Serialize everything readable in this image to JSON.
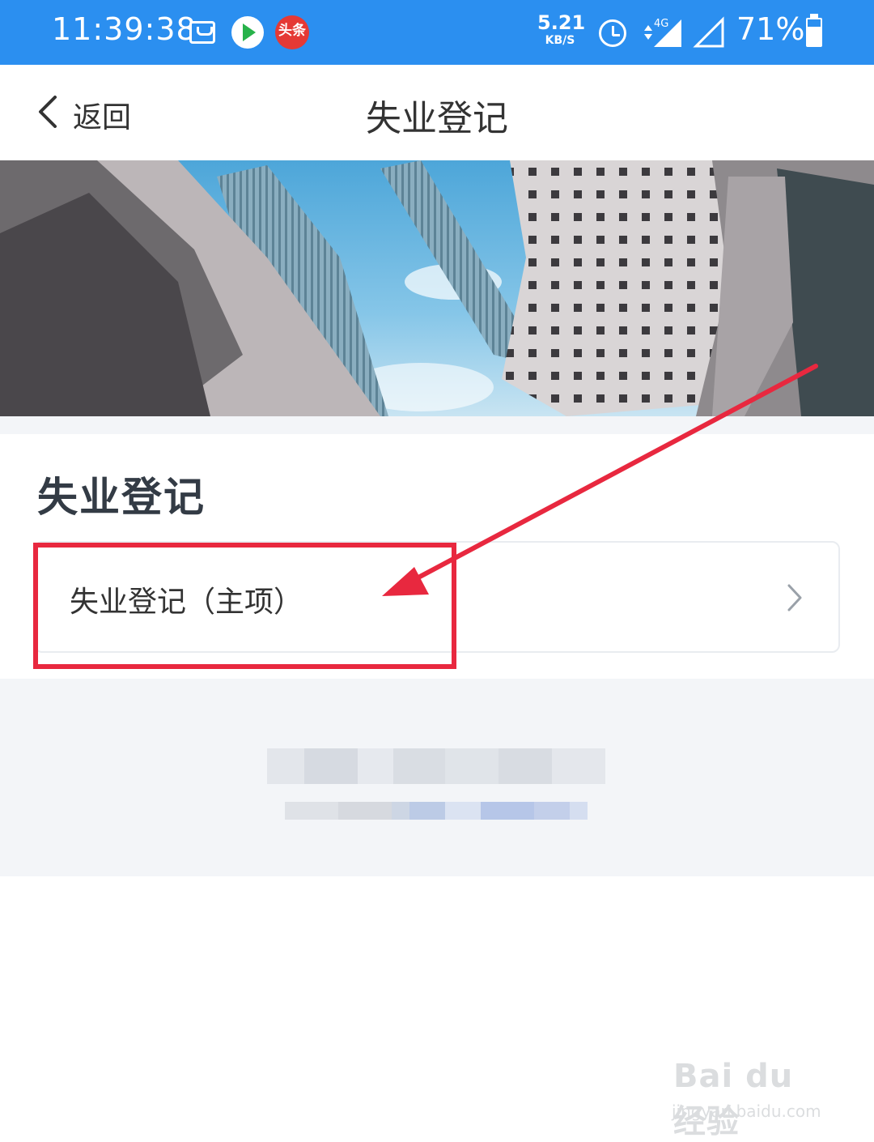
{
  "status_bar": {
    "time": "11:39:38",
    "net_speed_value": "5.21",
    "net_speed_unit": "KB/S",
    "network_type": "4G",
    "battery_percent": "71%",
    "toutiao_label": "头条",
    "icons": [
      "mail-icon",
      "video-app-icon",
      "toutiao-icon",
      "alarm-icon",
      "signal-4g-icon",
      "signal-icon",
      "battery-icon"
    ],
    "background_color": "#2b8ff0"
  },
  "nav": {
    "back_label": "返回",
    "title": "失业登记"
  },
  "banner": {
    "subject": "banner-image"
  },
  "section": {
    "title": "失业登记",
    "items": [
      {
        "label": "失业登记（主项）",
        "icon": "chevron-right-icon"
      }
    ]
  },
  "watermark": {
    "logo": "Bai du 经验",
    "url": "jingyan.baidu.com"
  },
  "colors": {
    "annotation_red": "#e8283f",
    "page_bg_gray": "#f3f5f8"
  }
}
